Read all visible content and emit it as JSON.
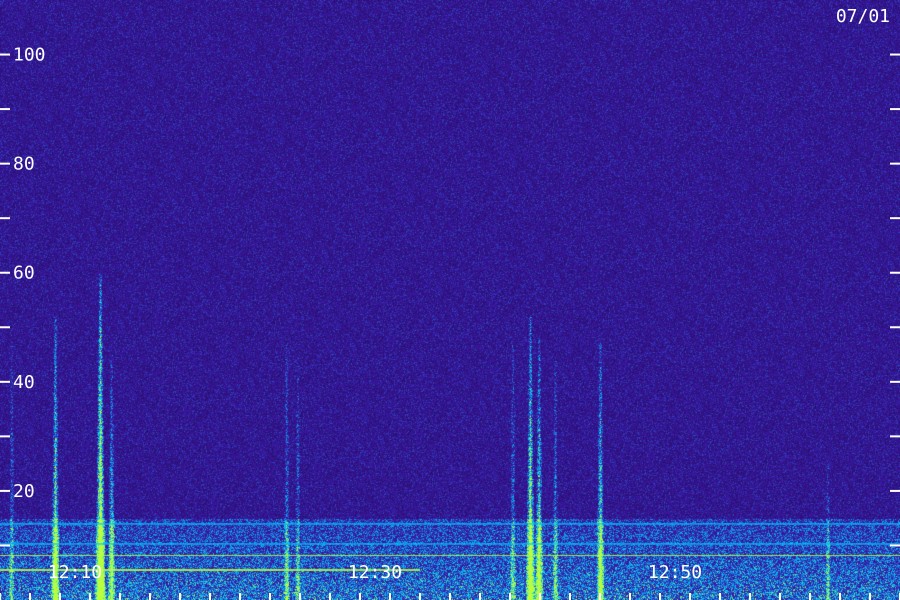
{
  "date_label": "07/01",
  "chart_data": {
    "type": "heatmap",
    "title": "",
    "xlabel": "",
    "ylabel": "",
    "x_range": [
      "12:05",
      "13:05"
    ],
    "ylim": [
      0,
      110
    ],
    "y_ticks": [
      {
        "value": 20,
        "label": "20"
      },
      {
        "value": 40,
        "label": "40"
      },
      {
        "value": 60,
        "label": "60"
      },
      {
        "value": 80,
        "label": "80"
      },
      {
        "value": 100,
        "label": "100"
      }
    ],
    "y_minor_ticks": [
      10,
      30,
      50,
      70,
      90
    ],
    "x_ticks": [
      {
        "value": "12:10",
        "label": "12:10"
      },
      {
        "value": "12:30",
        "label": "12:30"
      },
      {
        "value": "12:50",
        "label": "12:50"
      }
    ],
    "noise_floor_y": 15,
    "bursts": [
      {
        "time": "12:05:45",
        "y_max": 50,
        "intensity": 0.35
      },
      {
        "time": "12:08:40",
        "y_max": 52,
        "intensity": 0.75
      },
      {
        "time": "12:11:40",
        "y_max": 60,
        "intensity": 1.0
      },
      {
        "time": "12:12:25",
        "y_max": 45,
        "intensity": 0.6
      },
      {
        "time": "12:24:05",
        "y_max": 47,
        "intensity": 0.4
      },
      {
        "time": "12:24:50",
        "y_max": 45,
        "intensity": 0.35
      },
      {
        "time": "12:39:10",
        "y_max": 48,
        "intensity": 0.4
      },
      {
        "time": "12:40:20",
        "y_max": 52,
        "intensity": 0.85
      },
      {
        "time": "12:40:55",
        "y_max": 48,
        "intensity": 0.7
      },
      {
        "time": "12:42:00",
        "y_max": 44,
        "intensity": 0.4
      },
      {
        "time": "12:45:00",
        "y_max": 48,
        "intensity": 0.7
      },
      {
        "time": "13:00:10",
        "y_max": 25,
        "intensity": 0.35
      }
    ],
    "colors": {
      "background": "#2a0e6e",
      "low": "#3a1aa8",
      "mid": "#00c8ff",
      "high": "#b8ff40",
      "axis": "#ffffff"
    }
  }
}
